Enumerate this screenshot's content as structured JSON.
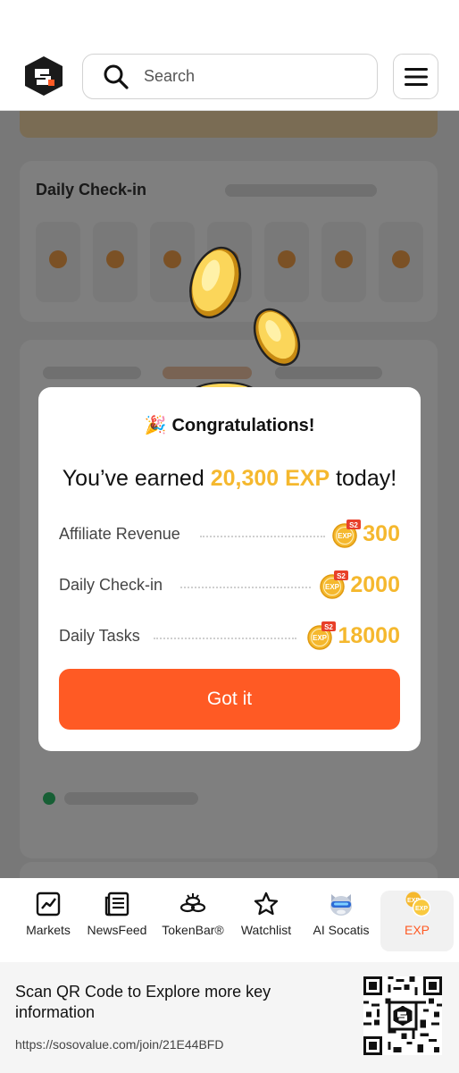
{
  "header": {
    "search_placeholder": "Search"
  },
  "background": {
    "section_title": "Daily Check-in"
  },
  "modal": {
    "emoji": "🎉",
    "title": "Congratulations!",
    "earned_prefix": "You’ve earned ",
    "earned_amount": "20,300 EXP",
    "earned_suffix": " today!",
    "rewards": [
      {
        "label": "Affiliate Revenue",
        "value": "300",
        "badge": "S2",
        "coin_text": "EXP"
      },
      {
        "label": "Daily Check-in",
        "value": "2000",
        "badge": "S2",
        "coin_text": "EXP"
      },
      {
        "label": "Daily Tasks",
        "value": "18000",
        "badge": "S2",
        "coin_text": "EXP"
      }
    ],
    "button_label": "Got it"
  },
  "bottom_nav": {
    "items": [
      {
        "label": "Markets",
        "icon": "chart-icon"
      },
      {
        "label": "NewsFeed",
        "icon": "newspaper-icon"
      },
      {
        "label": "TokenBar®",
        "icon": "token-icon"
      },
      {
        "label": "Watchlist",
        "icon": "star-icon"
      },
      {
        "label": "AI Socatis",
        "icon": "cat-avatar-icon"
      },
      {
        "label": "EXP",
        "icon": "exp-coin-icon"
      }
    ],
    "active_color": "#ff5a24"
  },
  "qr_footer": {
    "title": "Scan QR Code to Explore more key information",
    "url": "https://sosovalue.com/join/21E44BFD"
  },
  "colors": {
    "accent": "#ff5a24",
    "gold": "#f5b82e"
  }
}
